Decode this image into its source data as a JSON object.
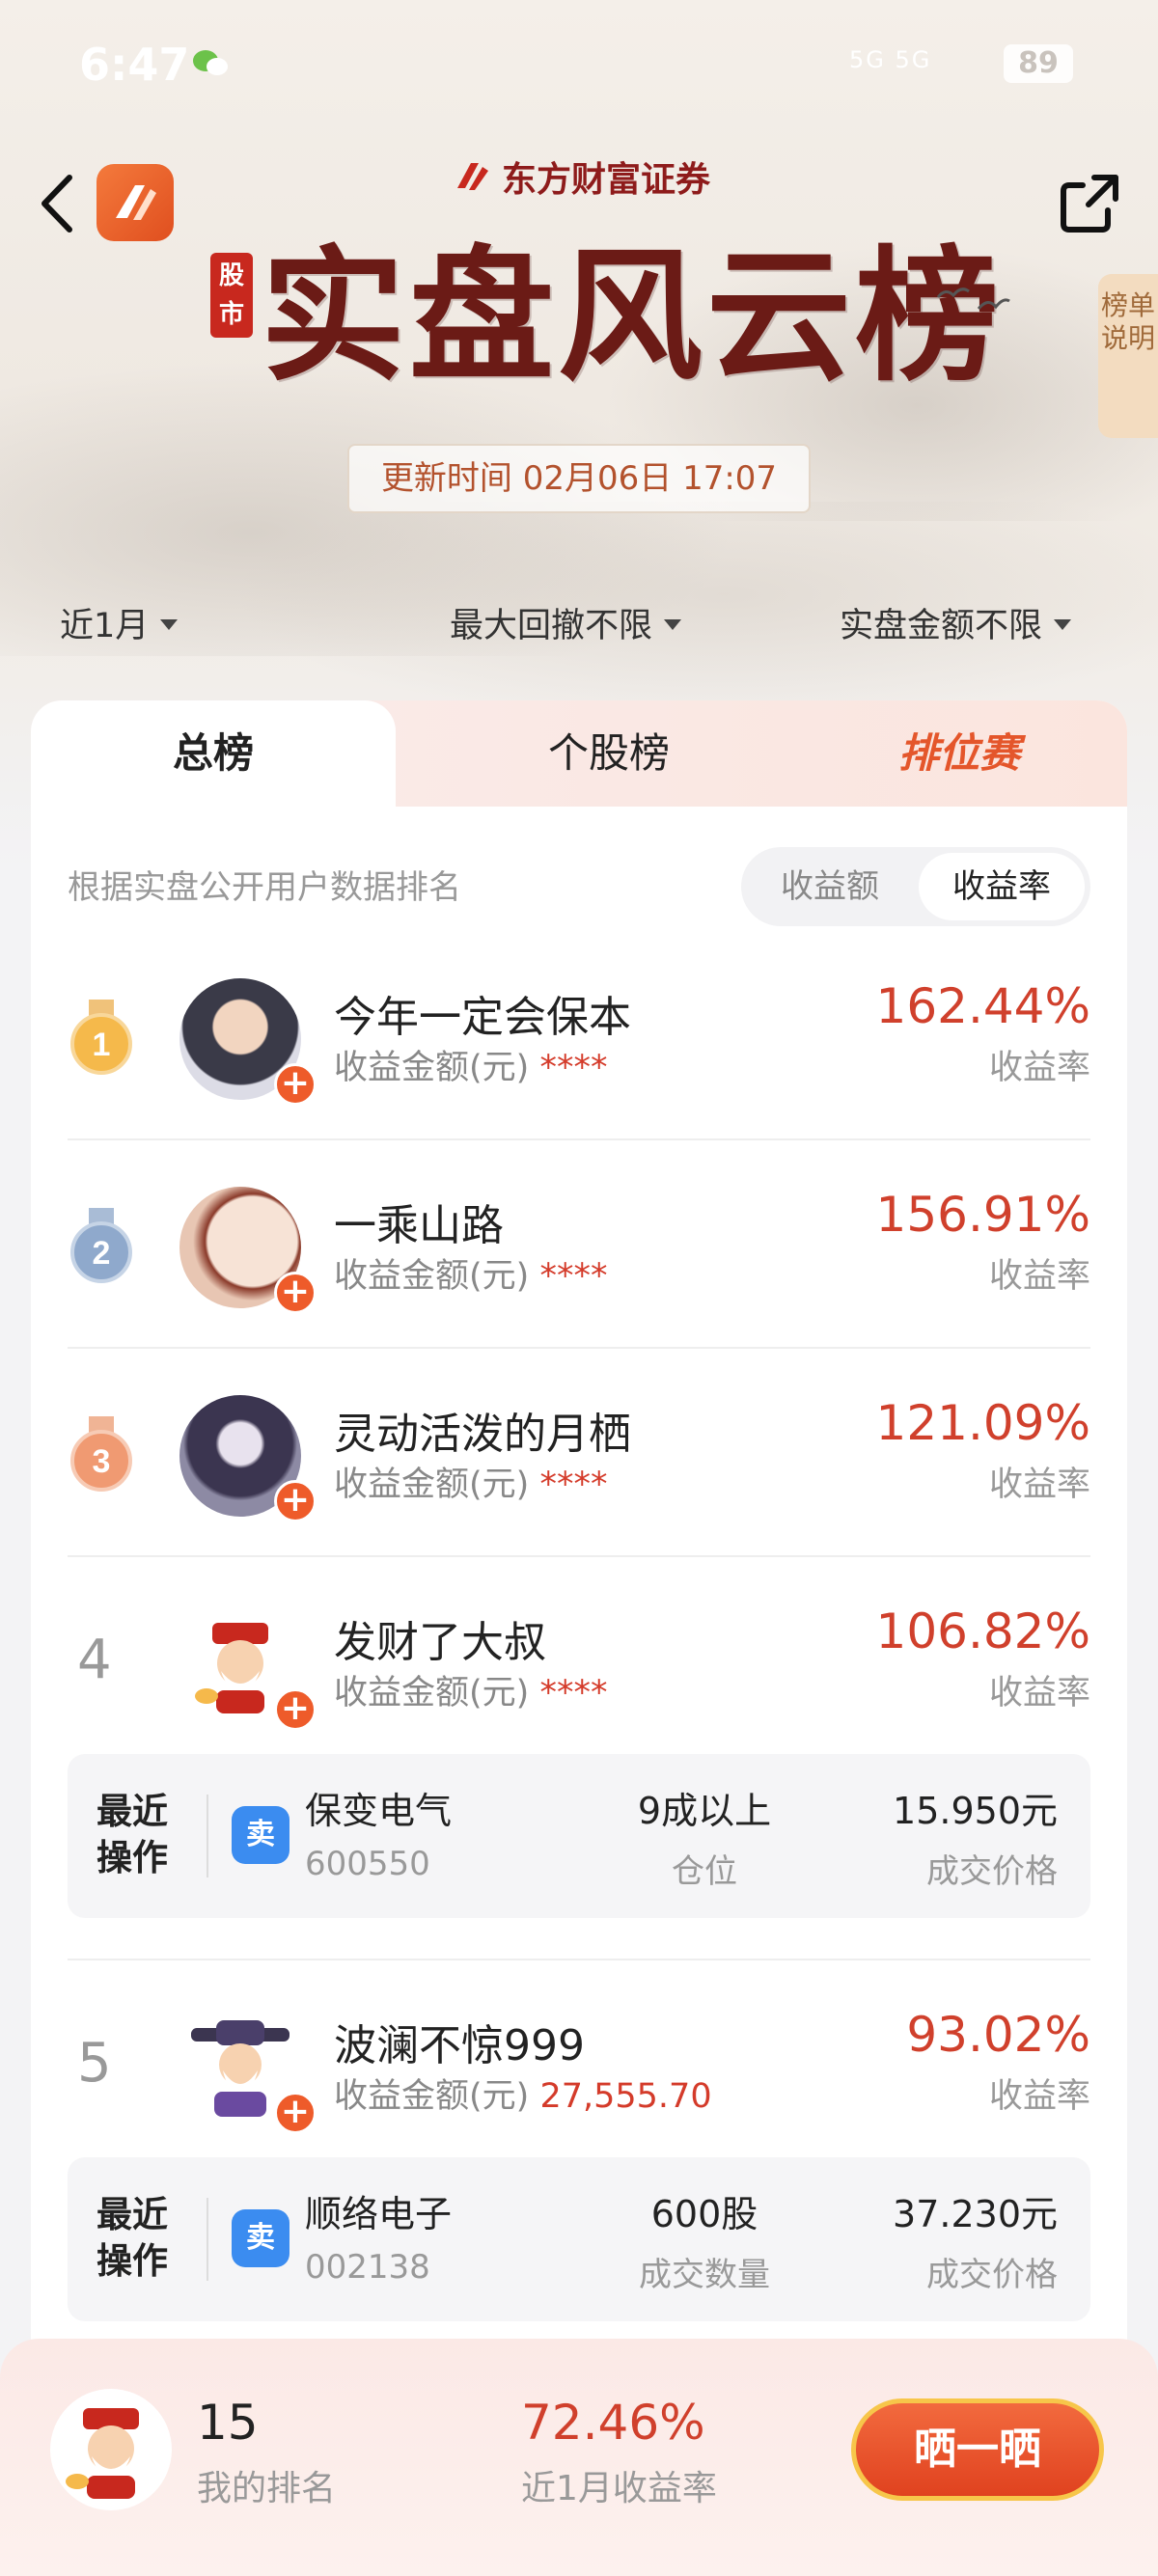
{
  "status_bar": {
    "time": "6:47",
    "signal": "5G 5G",
    "battery": "89"
  },
  "header": {
    "brand": "东方财富证券",
    "tag": "股市",
    "title": "实盘风云榜",
    "rules_tab": "榜单说明",
    "update_time": "更新时间 02月06日 17:07"
  },
  "filters": [
    {
      "label": "近1月"
    },
    {
      "label": "最大回撤不限"
    },
    {
      "label": "实盘金额不限"
    }
  ],
  "tabs": [
    {
      "label": "总榜",
      "active": true
    },
    {
      "label": "个股榜",
      "active": false
    },
    {
      "label": "排位赛",
      "active": false
    }
  ],
  "list_header": {
    "description": "根据实盘公开用户数据排名",
    "segments": [
      {
        "label": "收益额",
        "active": false
      },
      {
        "label": "收益率",
        "active": true
      }
    ]
  },
  "rankings": [
    {
      "rank": "1",
      "name": "今年一定会保本",
      "amount_label": "收益金额(元)",
      "amount": "****",
      "pct": "162.44%",
      "pct_label": "收益率"
    },
    {
      "rank": "2",
      "name": "一乘山路",
      "amount_label": "收益金额(元)",
      "amount": "****",
      "pct": "156.91%",
      "pct_label": "收益率"
    },
    {
      "rank": "3",
      "name": "灵动活泼的月栖",
      "amount_label": "收益金额(元)",
      "amount": "****",
      "pct": "121.09%",
      "pct_label": "收益率"
    },
    {
      "rank": "4",
      "name": "发财了大叔",
      "amount_label": "收益金额(元)",
      "amount": "****",
      "pct": "106.82%",
      "pct_label": "收益率",
      "recent_op": {
        "title": "最近操作",
        "action": "卖",
        "stock_name": "保变电气",
        "stock_code": "600550",
        "mid_value": "9成以上",
        "mid_label": "仓位",
        "right_value": "15.950元",
        "right_label": "成交价格"
      }
    },
    {
      "rank": "5",
      "name": "波澜不惊999",
      "amount_label": "收益金额(元)",
      "amount": "27,555.70",
      "pct": "93.02%",
      "pct_label": "收益率",
      "recent_op": {
        "title": "最近操作",
        "action": "卖",
        "stock_name": "顺络电子",
        "stock_code": "002138",
        "mid_value": "600股",
        "mid_label": "成交数量",
        "right_value": "37.230元",
        "right_label": "成交价格"
      }
    }
  ],
  "my_stats": {
    "rank": "15",
    "rank_label": "我的排名",
    "pct": "72.46%",
    "pct_label": "近1月收益率",
    "cta": "晒一晒"
  },
  "colors": {
    "accent": "#e4562b",
    "gain": "#d0402c",
    "sell_badge": "#3b8cf0"
  }
}
